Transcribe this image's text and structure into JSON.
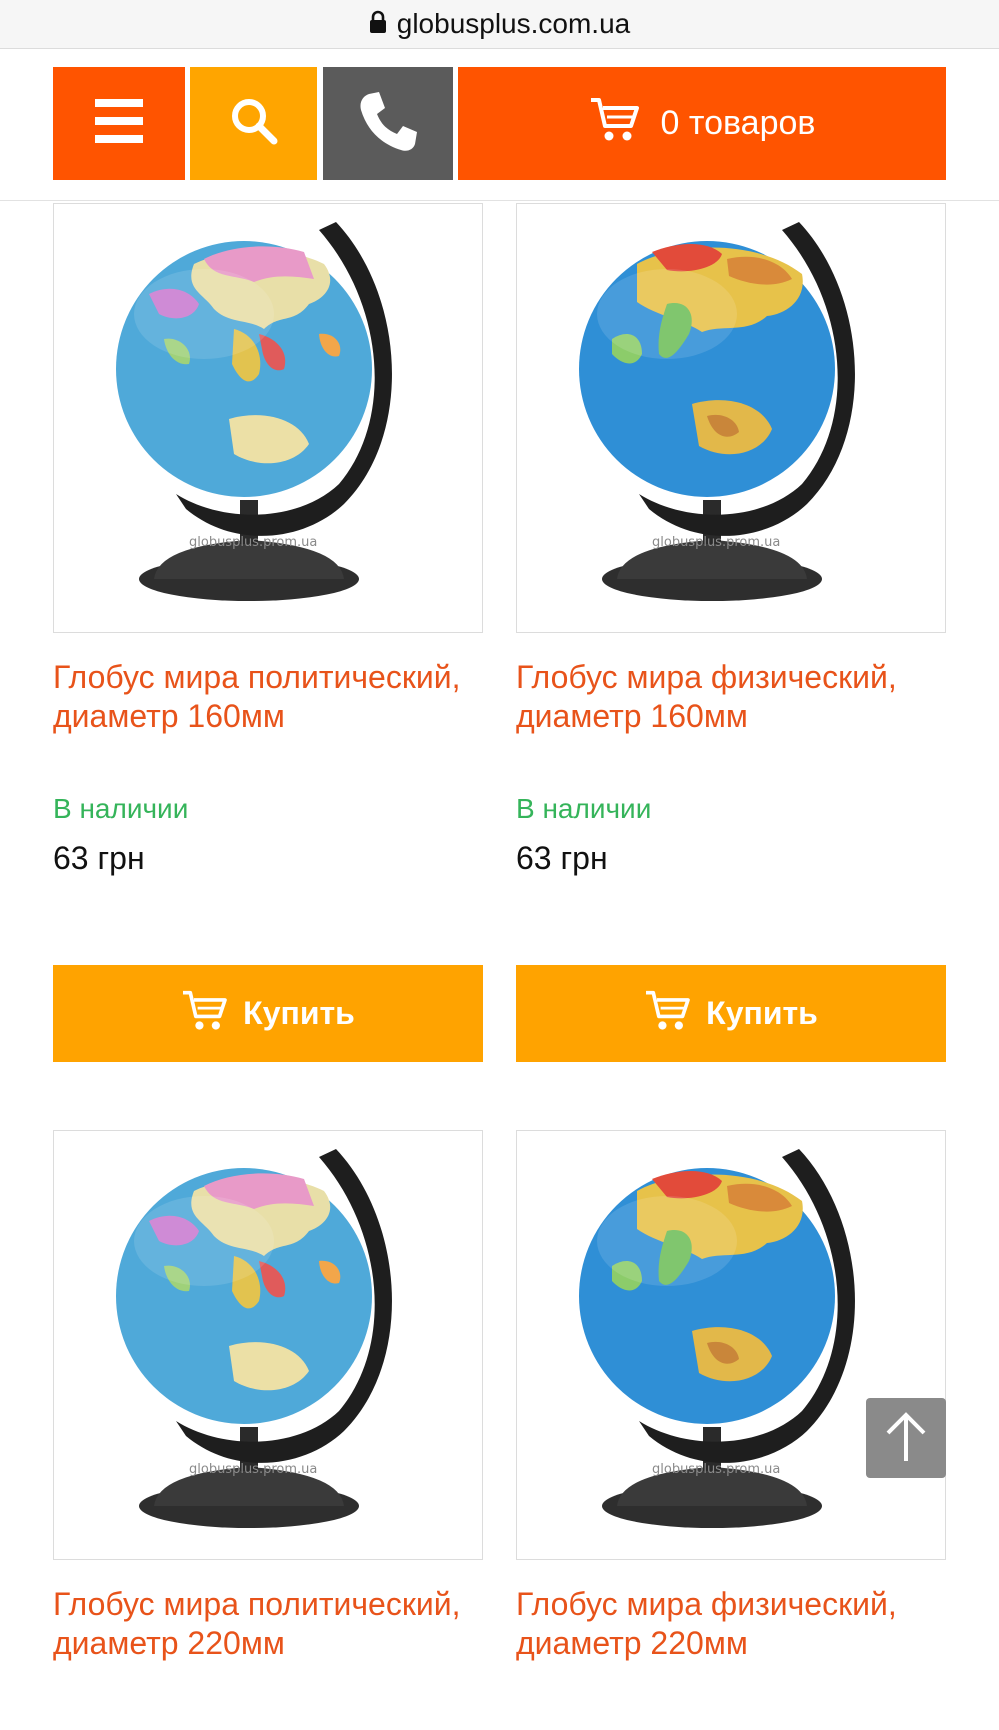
{
  "browser": {
    "url": "globusplus.com.ua"
  },
  "header": {
    "cart_label": "0 товаров"
  },
  "products": [
    {
      "title": "Глобус мира политический, диаметр 160мм",
      "stock": "В наличии",
      "price": "63 грн",
      "buy_label": "Купить",
      "globe_type": "political",
      "watermark": "globusplus.prom.ua"
    },
    {
      "title": "Глобус мира физический, диаметр 160мм",
      "stock": "В наличии",
      "price": "63 грн",
      "buy_label": "Купить",
      "globe_type": "physical",
      "watermark": "globusplus.prom.ua"
    },
    {
      "title": "Глобус мира политический, диаметр 220мм",
      "globe_type": "political",
      "watermark": "globusplus.prom.ua"
    },
    {
      "title": "Глобус мира физический, диаметр 220мм",
      "globe_type": "physical",
      "watermark": "globusplus.prom.ua"
    }
  ],
  "colors": {
    "brand_orange": "#ff5400",
    "accent_yellow": "#ffa500",
    "phone_gray": "#5b5b5b",
    "title_color": "#e8531a",
    "stock_green": "#35b45a",
    "buy_button": "#ffa300"
  }
}
